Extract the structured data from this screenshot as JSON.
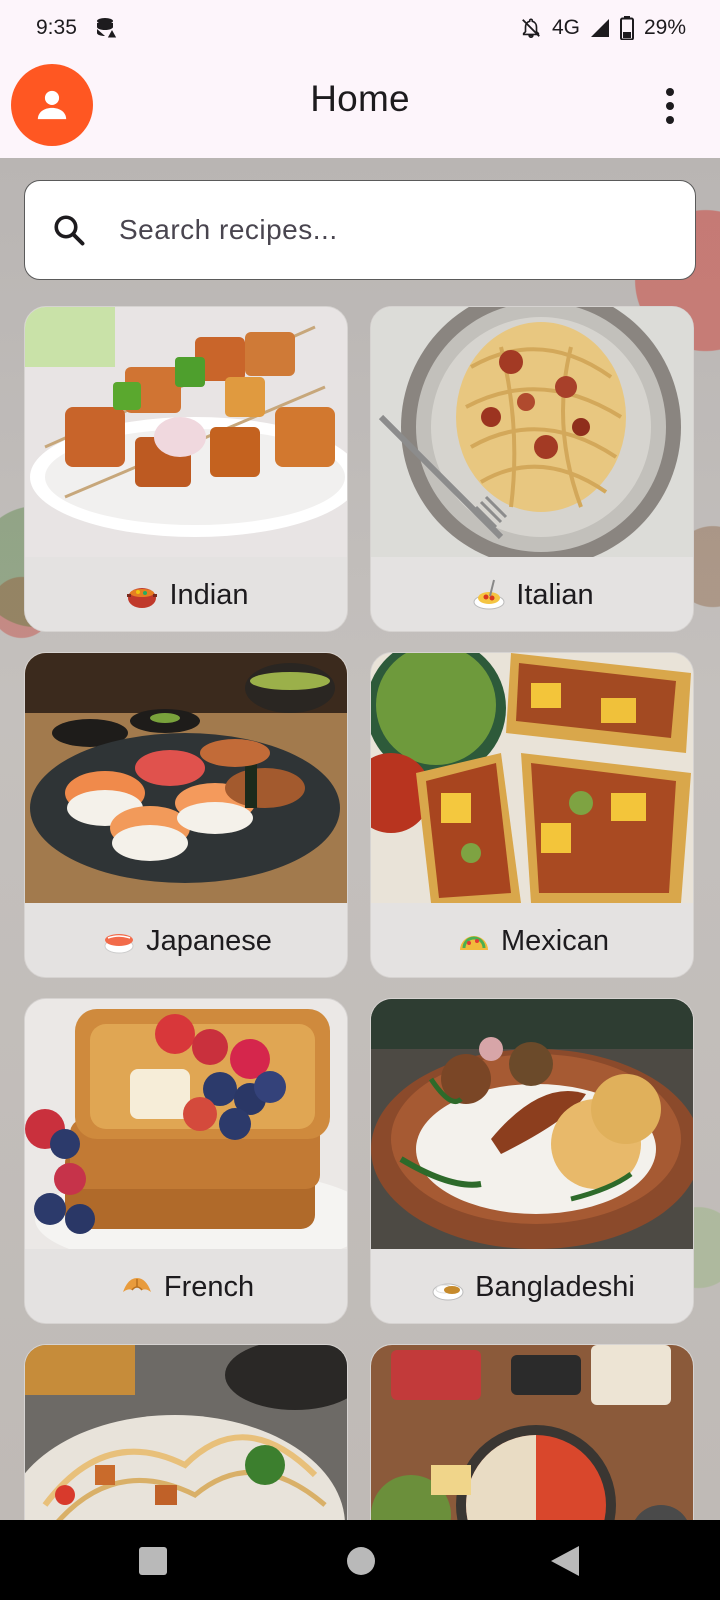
{
  "status_bar": {
    "time": "9:35",
    "network": "4G",
    "battery": "29%",
    "icons": [
      "data-saver-icon",
      "notifications-off-icon",
      "signal-icon",
      "battery-icon"
    ]
  },
  "app_bar": {
    "title": "Home",
    "avatar_icon": "person-icon",
    "menu_icon": "more-vert-icon",
    "accent_color": "#ff5722"
  },
  "search": {
    "placeholder": "Search recipes...",
    "value": "",
    "icon": "search-icon"
  },
  "cuisines": [
    {
      "label": "Indian",
      "emoji_icon": "curry-pot-icon",
      "photo": "paneer-tikka-skewers"
    },
    {
      "label": "Italian",
      "emoji_icon": "spaghetti-icon",
      "photo": "spaghetti-plate"
    },
    {
      "label": "Japanese",
      "emoji_icon": "sushi-icon",
      "photo": "sushi-platter"
    },
    {
      "label": "Mexican",
      "emoji_icon": "taco-icon",
      "photo": "tacos-guacamole"
    },
    {
      "label": "French",
      "emoji_icon": "croissant-icon",
      "photo": "french-toast-berries"
    },
    {
      "label": "Bangladeshi",
      "emoji_icon": "curry-rice-icon",
      "photo": "rice-fish-curry"
    },
    {
      "label": "",
      "emoji_icon": "",
      "photo": "noodle-salad"
    },
    {
      "label": "",
      "emoji_icon": "",
      "photo": "hot-pot-spread"
    }
  ],
  "nav_bar": {
    "buttons": [
      "recents-button",
      "home-button",
      "back-button"
    ]
  }
}
